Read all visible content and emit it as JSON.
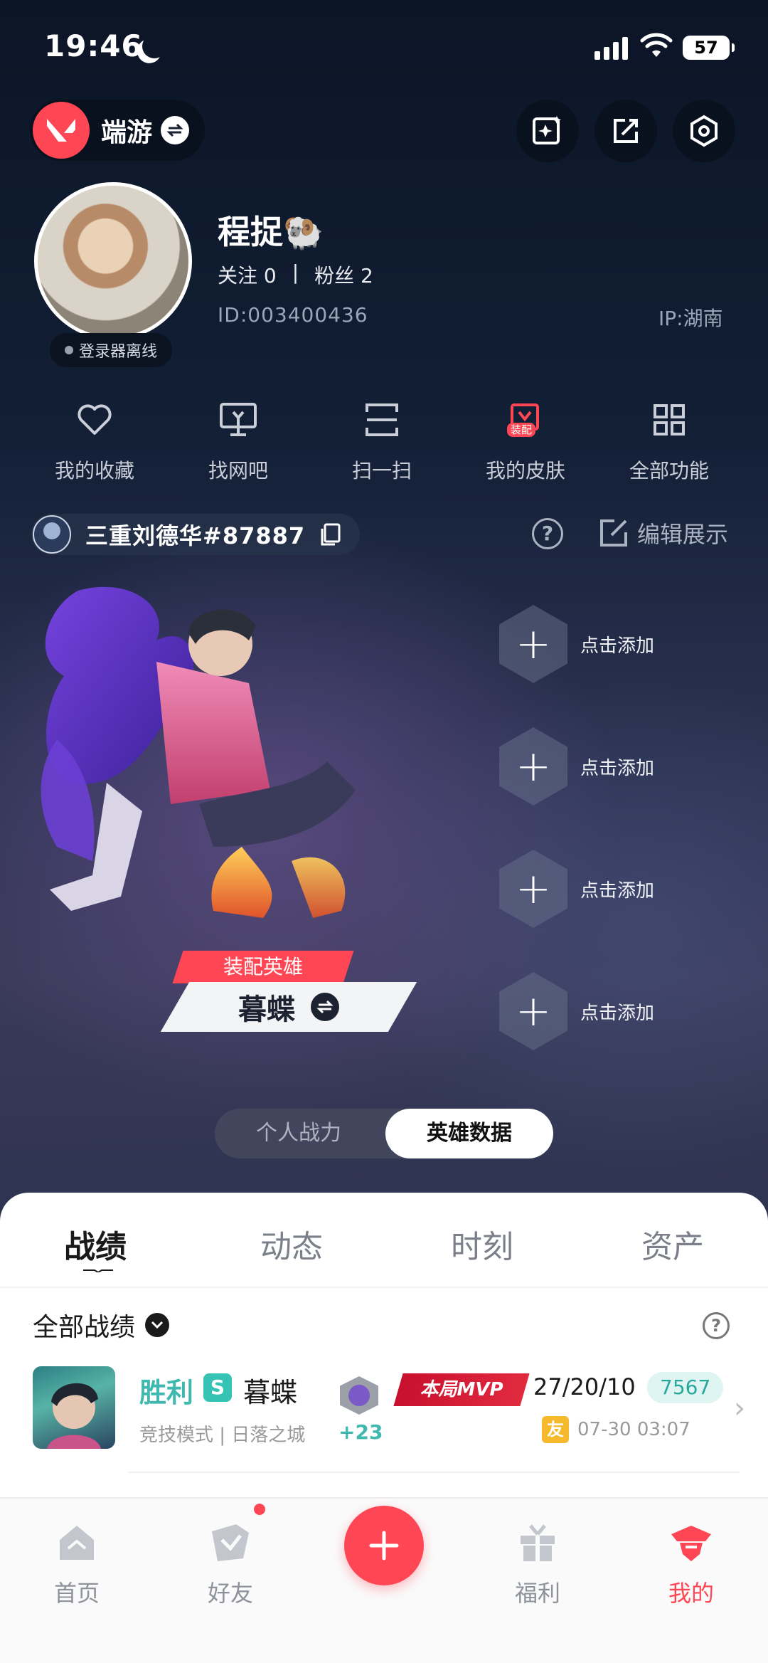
{
  "status_bar": {
    "time": "19:46",
    "battery": "57"
  },
  "top_bar": {
    "game_name": "端游"
  },
  "profile": {
    "username": "程捉🐏",
    "follow_label": "关注 0",
    "separator": "|",
    "fans_label": "粉丝 2",
    "id": "ID:003400436",
    "ip": "IP:湖南",
    "login_status": "登录器离线"
  },
  "quick_menu": [
    {
      "label": "我的收藏",
      "icon": "heart-icon"
    },
    {
      "label": "找网吧",
      "icon": "monitor-icon"
    },
    {
      "label": "扫一扫",
      "icon": "scan-icon"
    },
    {
      "label": "我的皮肤",
      "icon": "skin-icon",
      "badge": "装配"
    },
    {
      "label": "全部功能",
      "icon": "grid-icon"
    }
  ],
  "account": {
    "name": "三重刘德华#87887",
    "edit_label": "编辑展示",
    "help": "?"
  },
  "hero": {
    "tag": "装配英雄",
    "name": "暮蝶"
  },
  "slots": [
    "点击添加",
    "点击添加",
    "点击添加",
    "点击添加"
  ],
  "segment": {
    "option_a": "个人战力",
    "option_b": "英雄数据"
  },
  "tabs": [
    {
      "label": "战绩",
      "active": true
    },
    {
      "label": "动态",
      "active": false
    },
    {
      "label": "时刻",
      "active": false
    },
    {
      "label": "资产",
      "active": false
    }
  ],
  "filter": {
    "label": "全部战绩",
    "help": "?"
  },
  "matches": [
    {
      "result": "胜利",
      "mode_badge": "S",
      "agent": "暮蝶",
      "meta": "竞技模式 | 日落之城",
      "rank_delta": "+23",
      "mvp": "本局MVP",
      "kda": "27/20/10",
      "score": "7567",
      "friend_badge": "友",
      "time": "07-30 03:07",
      "chevron": "›"
    }
  ],
  "bottom_nav": [
    {
      "label": "首页",
      "icon": "home-icon",
      "active": false
    },
    {
      "label": "好友",
      "icon": "friends-icon",
      "active": false
    },
    {
      "label": "福利",
      "icon": "gift-icon",
      "active": false
    },
    {
      "label": "我的",
      "icon": "profile-icon",
      "active": true
    }
  ],
  "colors": {
    "accent": "#ff4655",
    "teal": "#3fb9b0",
    "bg_dark": "#0f1a2c"
  }
}
